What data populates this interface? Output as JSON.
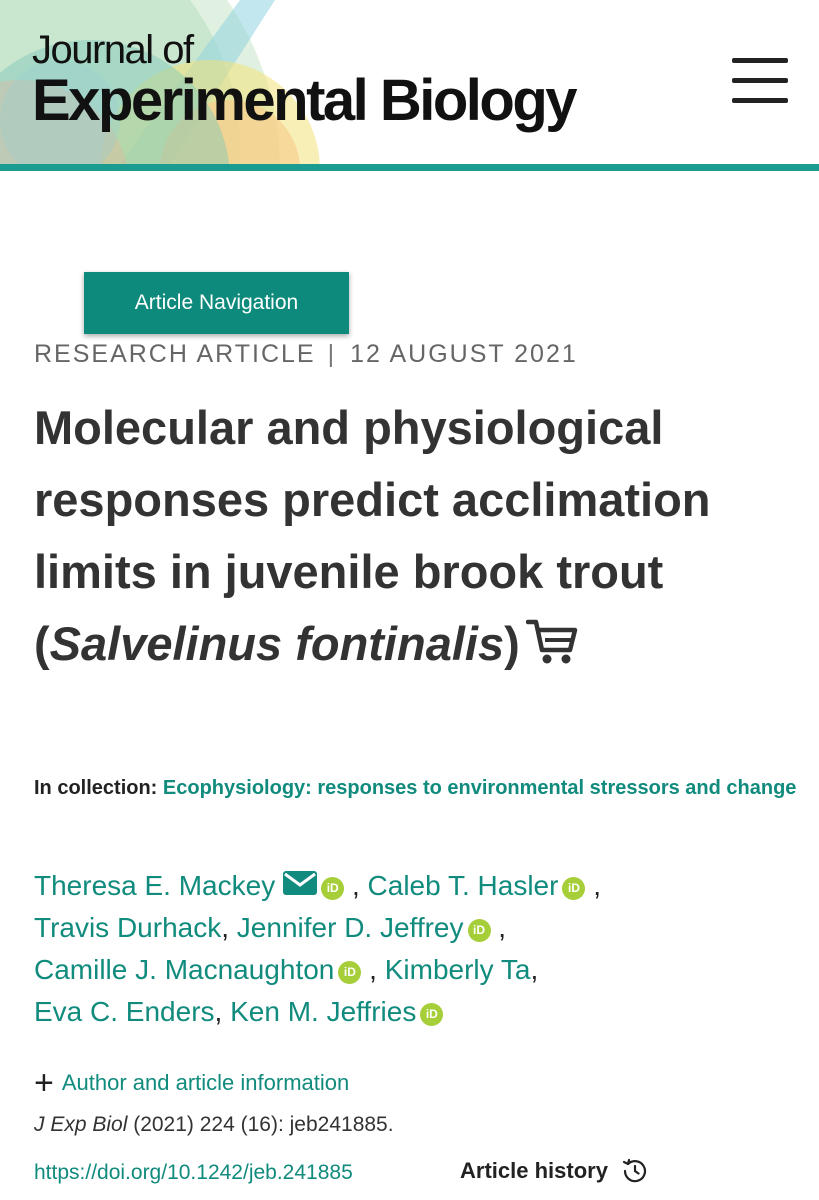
{
  "header": {
    "logo_line1": "Journal of",
    "logo_line2": "Experimental Biology",
    "menu_icon": "hamburger-menu-icon",
    "accent_color": "#1a9c90"
  },
  "article_nav": {
    "label": "Article Navigation",
    "color": "#0d8a7c"
  },
  "meta": {
    "type": "RESEARCH ARTICLE",
    "separator": "|",
    "date": "12 AUGUST 2021"
  },
  "title": {
    "part1": "Molecular and physiological responses predict acclimation limits in juvenile brook trout (",
    "species": "Salvelinus fontinalis",
    "part2": ")",
    "cart_icon": "shopping-cart-icon"
  },
  "collection": {
    "label": "In collection:",
    "name": "Ecophysiology: responses to environmental stressors and change"
  },
  "authors": [
    {
      "name": "Theresa E. Mackey",
      "email_icon": true,
      "orcid": true
    },
    {
      "name": "Caleb T. Hasler",
      "orcid": true
    },
    {
      "name": "Travis Durhack",
      "orcid": false
    },
    {
      "name": "Jennifer D. Jeffrey",
      "orcid": true
    },
    {
      "name": "Camille J. Macnaughton",
      "orcid": true
    },
    {
      "name": "Kimberly Ta",
      "orcid": false
    },
    {
      "name": "Eva C. Enders",
      "orcid": false
    },
    {
      "name": "Ken M. Jeffries",
      "orcid": true
    }
  ],
  "orcid_label": "iD",
  "author_info": {
    "icon": "plus-icon",
    "label": "Author and article information"
  },
  "citation": {
    "journal": "J Exp Biol",
    "details": " (2021) 224 (16): jeb241885."
  },
  "doi": "https://doi.org/10.1242/jeb.241885",
  "history": {
    "label": "Article history",
    "icon": "history-clock-icon"
  },
  "colors": {
    "link": "#108b7d",
    "orcid": "#a6ce39",
    "text": "#333333"
  }
}
